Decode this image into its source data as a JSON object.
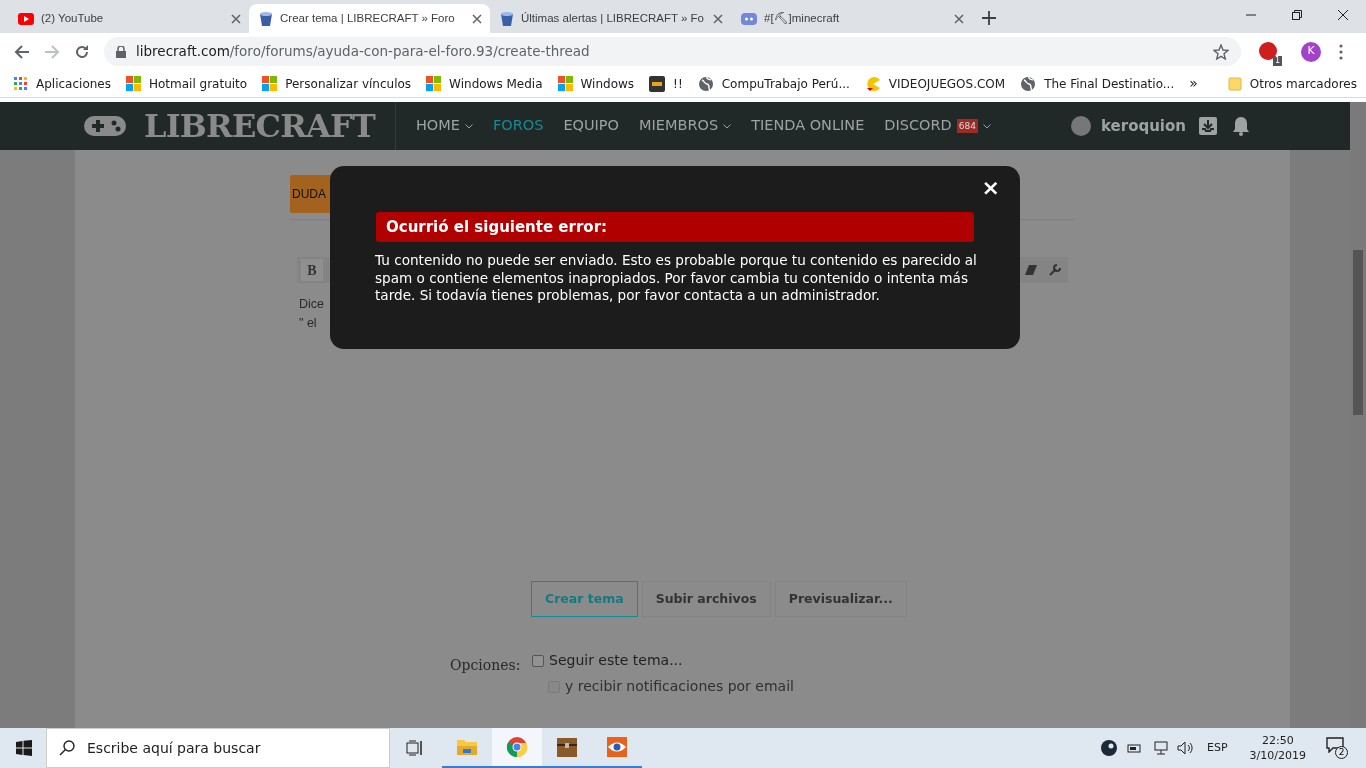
{
  "browser": {
    "tabs": [
      {
        "title": "(2) YouTube",
        "kind": "youtube",
        "selected": false
      },
      {
        "title": "Crear tema | LIBRECRAFT » Foro",
        "kind": "bucket",
        "selected": true
      },
      {
        "title": "Últimas alertas | LIBRECRAFT » Fo",
        "kind": "bucket",
        "selected": false
      },
      {
        "title": "#[⛏]minecraft",
        "kind": "discord",
        "selected": false
      }
    ],
    "url_host": "librecraft.com",
    "url_path": "/foro/forums/ayuda-con-para-el-foro.93/create-thread",
    "extension_badge": "1",
    "profile_initial": "K",
    "bookmarks": [
      {
        "label": "Aplicaciones",
        "kind": "apps"
      },
      {
        "label": "Hotmail gratuito",
        "kind": "windows"
      },
      {
        "label": "Personalizar vínculos",
        "kind": "windows"
      },
      {
        "label": "Windows Media",
        "kind": "windows"
      },
      {
        "label": "Windows",
        "kind": "windows"
      },
      {
        "label": "!!",
        "kind": "dark"
      },
      {
        "label": "CompuTrabajo Perú...",
        "kind": "globe"
      },
      {
        "label": "VIDEOJUEGOS.COM",
        "kind": "pacman"
      },
      {
        "label": "The Final Destinatio...",
        "kind": "globe"
      }
    ],
    "overflow": "»",
    "other_bookmarks": "Otros marcadores"
  },
  "site": {
    "logo": "LIBRECRAFT",
    "nav": [
      {
        "label": "HOME",
        "dropdown": true,
        "selected": false
      },
      {
        "label": "FOROS",
        "dropdown": false,
        "selected": true
      },
      {
        "label": "EQUIPO",
        "dropdown": false,
        "selected": false
      },
      {
        "label": "MIEMBROS",
        "dropdown": true,
        "selected": false
      },
      {
        "label": "TIENDA ONLINE",
        "dropdown": false,
        "selected": false
      },
      {
        "label": "DISCORD",
        "dropdown": true,
        "selected": false,
        "badge": "684"
      }
    ],
    "user": "keroquion"
  },
  "thread": {
    "prefix": "DUDA",
    "toolbar": [
      "B"
    ],
    "message": [
      "Dice",
      "\" el"
    ],
    "buttons": [
      {
        "label": "Crear tema",
        "primary": true
      },
      {
        "label": "Subir archivos",
        "primary": false
      },
      {
        "label": "Previsualizar...",
        "primary": false
      }
    ],
    "options_label": "Opciones:",
    "options": [
      {
        "label": "Seguir este tema...",
        "checked": false,
        "disabled": false
      },
      {
        "label": "y recibir notificaciones por email",
        "checked": false,
        "disabled": true
      }
    ]
  },
  "modal": {
    "header": "Ocurrió el siguiente error:",
    "message": "Tu contenido no puede ser enviado. Esto es probable porque tu contenido es parecido al spam o contiene elementos inapropiados. Por favor cambia tu contenido o intenta más tarde. Si todavía tienes problemas, por favor contacta a un administrador.",
    "close": "×"
  },
  "taskbar": {
    "search_placeholder": "Escribe aquí para buscar",
    "apps": [
      {
        "kind": "folder",
        "selected": false
      },
      {
        "kind": "chrome",
        "selected": true
      },
      {
        "kind": "chest",
        "selected": false
      },
      {
        "kind": "eye",
        "selected": false
      }
    ],
    "language": "ESP",
    "time": "22:50",
    "date": "3/10/2019",
    "notifications": "2"
  }
}
